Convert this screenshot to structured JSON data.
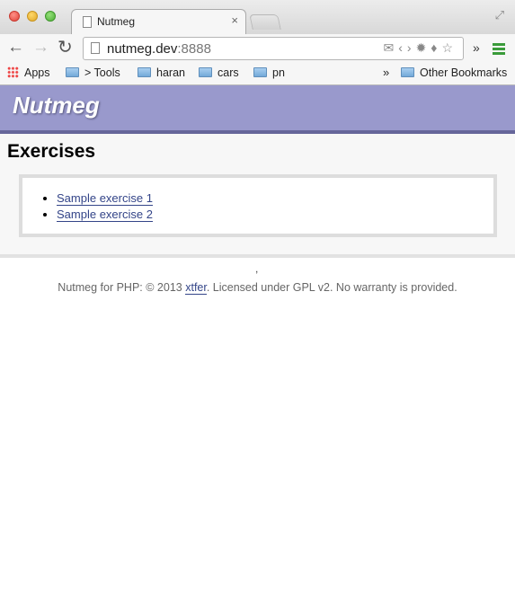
{
  "browser": {
    "tab_title": "Nutmeg",
    "tab_close": "×",
    "url_host": "nutmeg.dev",
    "url_port": ":8888",
    "omnibox_icons": "✉‹›✹♦☆",
    "overflow_chevron": "»",
    "bookmarks": [
      {
        "label": "Apps",
        "icon": "apps-grid-icon"
      },
      {
        "label": "> Tools",
        "icon": "folder-icon"
      },
      {
        "label": "haran",
        "icon": "folder-icon"
      },
      {
        "label": "cars",
        "icon": "folder-icon"
      },
      {
        "label": "pn",
        "icon": "folder-icon"
      }
    ],
    "bookmarks_more": "»",
    "other_bookmarks": "Other Bookmarks"
  },
  "site": {
    "logo": "Nutmeg",
    "brand_color": "#9999cc"
  },
  "main": {
    "title": "Exercises",
    "exercises": [
      "Sample exercise 1",
      "Sample exercise 2"
    ]
  },
  "footer": {
    "separator": ",",
    "text_before": "Nutmeg for PHP: © 2013 ",
    "link": "xtfer",
    "text_after": ". Licensed under GPL v2. No warranty is provided."
  }
}
